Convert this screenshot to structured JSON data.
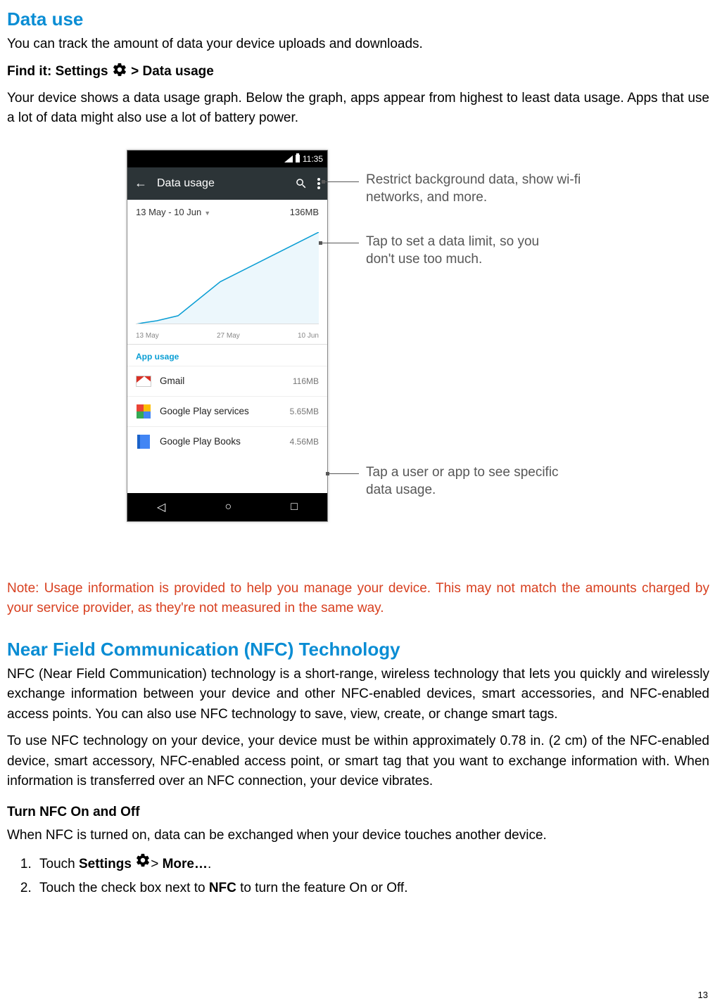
{
  "section1": {
    "title": "Data use",
    "intro": "You can track the amount of data your device uploads and downloads.",
    "findit_prefix": "Find it: Settings ",
    "findit_suffix": "> Data usage",
    "graphdesc": "Your device shows a data usage graph. Below the graph, apps appear from highest to least data usage. Apps that use a lot of data might also use a lot of battery power."
  },
  "screenshot": {
    "time": "11:35",
    "appbar_title": "Data usage",
    "date_range": "13 May - 10 Jun",
    "total": "136MB",
    "axis": [
      "13 May",
      "27 May",
      "10 Jun"
    ],
    "app_usage_label": "App usage",
    "apps": [
      {
        "name": "Gmail",
        "value": "116MB"
      },
      {
        "name": "Google Play services",
        "value": "5.65MB"
      },
      {
        "name": "Google Play Books",
        "value": "4.56MB"
      }
    ]
  },
  "callouts": {
    "c1": "Restrict background data, show wi-fi networks, and more.",
    "c2": "Tap to set a data limit, so you don't use too much.",
    "c3": "Tap a user or app to see specific data usage."
  },
  "note": "Note: Usage information is provided to help you manage your device. This may not match the amounts charged by your service provider, as they're not measured in the same way.",
  "section2": {
    "title": "Near Field Communication (NFC) Technology",
    "p1": "NFC (Near Field Communication) technology is a short-range, wireless technology that lets you quickly and wirelessly exchange information between your device and other NFC-enabled devices, smart accessories, and NFC-enabled access points. You can also use NFC technology to save, view, create, or change smart tags.",
    "p2": "To use NFC technology on your device, your device must be within approximately 0.78 in. (2 cm) of the NFC-enabled device, smart accessory, NFC-enabled access point, or smart tag that you want to exchange information with. When information is transferred over an NFC connection, your device vibrates.",
    "sub": "Turn NFC On and Off",
    "subp": "When NFC is turned on, data can be exchanged when your device touches another device.",
    "step1_a": "Touch ",
    "step1_b": "Settings ",
    "step1_c": "> ",
    "step1_d": "More…",
    "step1_e": ".",
    "step2_a": "Touch the check box next to ",
    "step2_b": "NFC",
    "step2_c": " to turn the feature On or Off."
  },
  "page": "13"
}
